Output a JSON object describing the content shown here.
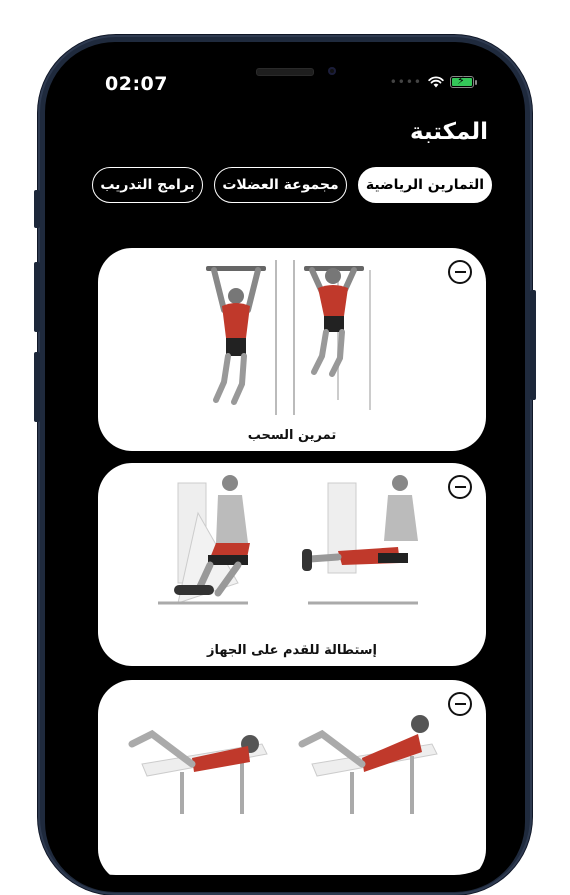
{
  "status_bar": {
    "time": "02:07"
  },
  "header": {
    "title": "المكتبة"
  },
  "tabs": [
    {
      "label": "التمارين الرياضية",
      "active": true
    },
    {
      "label": "مجموعة العضلات",
      "active": false
    },
    {
      "label": "برامج التدريب",
      "active": false
    }
  ],
  "exercises": [
    {
      "label": "تمرين السحب",
      "action_icon": "minus-circle-icon"
    },
    {
      "label": "إستطالة للقدم على الجهاز",
      "action_icon": "minus-circle-icon"
    },
    {
      "label": "",
      "action_icon": "minus-circle-icon"
    }
  ],
  "colors": {
    "background": "#000000",
    "card": "#ffffff",
    "muscle_highlight": "#d0392b",
    "battery": "#34c759"
  }
}
